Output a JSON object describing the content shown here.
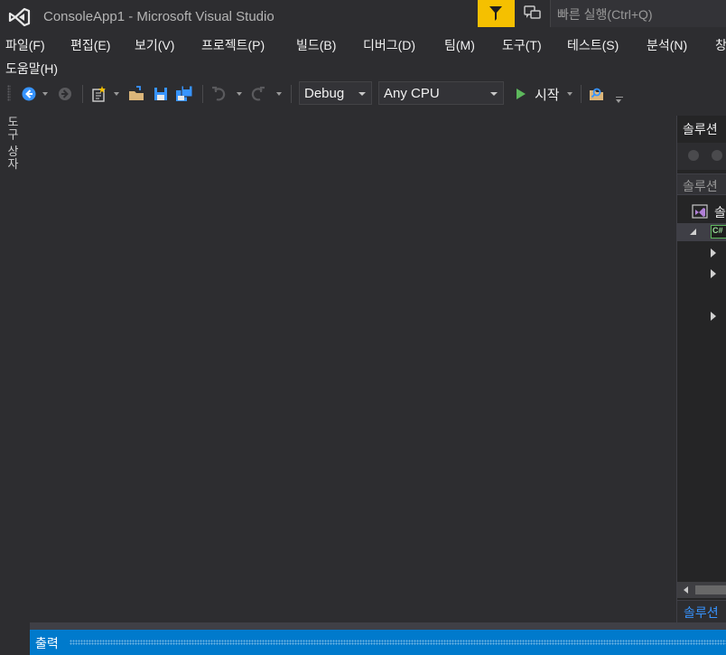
{
  "window": {
    "title": "ConsoleApp1 - Microsoft Visual Studio",
    "quick_launch_placeholder": "빠른 실행(Ctrl+Q)",
    "accent_color": "#007acc",
    "filter_color": "#f5c000"
  },
  "menu": {
    "file": "파일(F)",
    "edit": "편집(E)",
    "view": "보기(V)",
    "project": "프로젝트(P)",
    "build": "빌드(B)",
    "debug": "디버그(D)",
    "team": "팀(M)",
    "tools": "도구(T)",
    "test": "테스트(S)",
    "analyze": "분석(N)",
    "window": "창",
    "help": "도움말(H)"
  },
  "toolbar": {
    "configuration": "Debug",
    "platform": "Any CPU",
    "start_label": "시작"
  },
  "toolbox": {
    "label": "도구 상자"
  },
  "solution_explorer": {
    "title": "솔루션",
    "search_placeholder": "솔루션",
    "solution_node": "솔",
    "project_badge": "C#",
    "tab_label": "솔루션"
  },
  "output": {
    "title": "출력"
  }
}
